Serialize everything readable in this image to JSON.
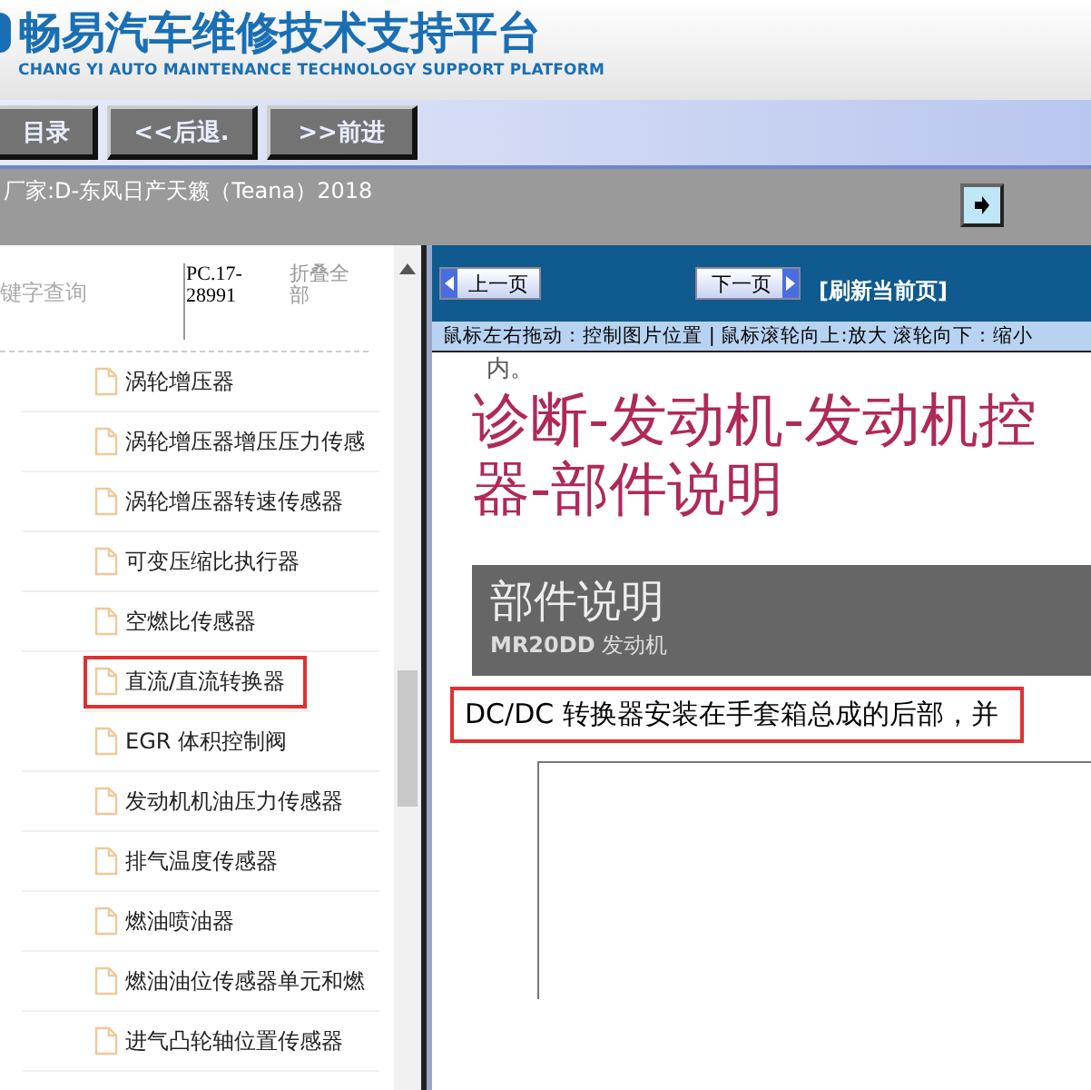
{
  "header": {
    "title": "畅易汽车维修技术支持平台",
    "subtitle": "CHANG YI AUTO MAINTENANCE TECHNOLOGY SUPPORT PLATFORM"
  },
  "nav_buttons": [
    "目录",
    "<<后退.",
    ">>前进"
  ],
  "info_bar": {
    "text": "厂家:D-东风日产天籁（Teana）2018"
  },
  "sidebar": {
    "search_placeholder": "键字查询",
    "code": "PC.17-28991",
    "collapse_all": "折叠全部",
    "items": [
      {
        "label": "涡轮增压器",
        "highlighted": false
      },
      {
        "label": "涡轮增压器增压压力传感",
        "highlighted": false
      },
      {
        "label": "涡轮增压器转速传感器",
        "highlighted": false
      },
      {
        "label": "可变压缩比执行器",
        "highlighted": false
      },
      {
        "label": "空燃比传感器",
        "highlighted": false
      },
      {
        "label": "直流/直流转换器",
        "highlighted": true
      },
      {
        "label": "EGR 体积控制阀",
        "highlighted": false
      },
      {
        "label": "发动机机油压力传感器",
        "highlighted": false
      },
      {
        "label": "排气温度传感器",
        "highlighted": false
      },
      {
        "label": "燃油喷油器",
        "highlighted": false
      },
      {
        "label": "燃油油位传感器单元和燃",
        "highlighted": false
      },
      {
        "label": "进气凸轮轴位置传感器",
        "highlighted": false
      }
    ]
  },
  "viewer": {
    "prev_button": "上一页",
    "next_button": "下一页",
    "refresh_link": "[刷新当前页]",
    "hint": "鼠标左右拖动：控制图片位置 | 鼠标滚轮向上:放大  滚轮向下：缩小",
    "document": {
      "top_text": "内。",
      "title_lines": [
        "诊断-发动机-发动机控",
        "器-部件说明"
      ],
      "banner_title": "部件说明",
      "banner_subtitle": "**MR20DD** 发动机",
      "paragraph": "DC/DC 转换器安装在手套箱总成的后部，并",
      "paragraph_highlighted": true
    }
  }
}
